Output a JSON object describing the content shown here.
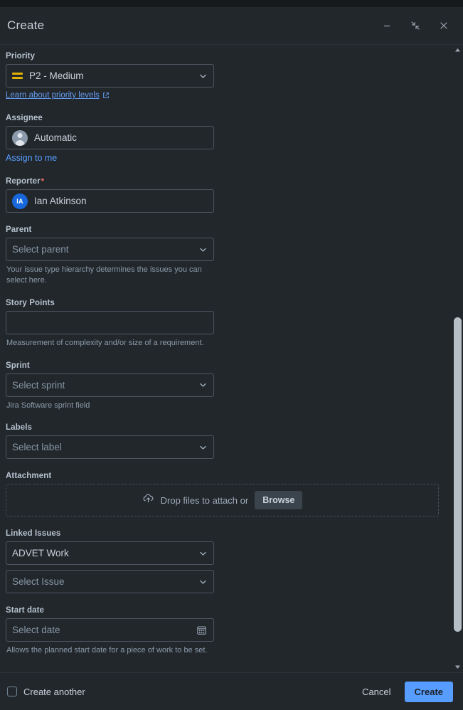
{
  "window": {
    "title": "Create",
    "controls": [
      {
        "name": "minimize-button",
        "glyph": "minimize"
      },
      {
        "name": "collapse-button",
        "glyph": "collapse"
      },
      {
        "name": "close-button",
        "glyph": "close"
      }
    ]
  },
  "colors": {
    "surface": "#22272b",
    "border": "#4c5662",
    "accent": "#579dff",
    "link": "#579dff",
    "priority_medium": "#e2b203",
    "avatar_blue": "#1868db",
    "required_star": "#f87168",
    "scrollbar_thumb": "#b6bec6"
  },
  "fields": {
    "priority": {
      "label": "Priority",
      "value": "P2 - Medium",
      "icon": "priority-medium-icon",
      "link_text": "Learn about priority levels",
      "link_icon": "external-link-icon"
    },
    "assignee": {
      "label": "Assignee",
      "value": "Automatic",
      "avatar": "generic-user-avatar",
      "action_text": "Assign to me"
    },
    "reporter": {
      "label": "Reporter",
      "required": "*",
      "value": "Ian Atkinson",
      "avatar_initials": "IA"
    },
    "parent": {
      "label": "Parent",
      "placeholder": "Select parent",
      "help": "Your issue type hierarchy determines the issues you can select here."
    },
    "story_points": {
      "label": "Story Points",
      "value": "",
      "help": "Measurement of complexity and/or size of a requirement."
    },
    "sprint": {
      "label": "Sprint",
      "placeholder": "Select sprint",
      "help": "Jira Software sprint field"
    },
    "labels": {
      "label": "Labels",
      "placeholder": "Select label"
    },
    "attachment": {
      "label": "Attachment",
      "drop_text": "Drop files to attach or",
      "browse_label": "Browse",
      "icon": "cloud-upload-icon"
    },
    "linked_issues": {
      "label": "Linked Issues",
      "link_type_value": "ADVET Work",
      "issue_placeholder": "Select Issue"
    },
    "start_date": {
      "label": "Start date",
      "placeholder": "Select date",
      "icon": "calendar-icon",
      "help": "Allows the planned start date for a piece of work to be set."
    }
  },
  "footer": {
    "create_another_label": "Create another",
    "create_another_checked": false,
    "cancel_label": "Cancel",
    "create_label": "Create"
  }
}
